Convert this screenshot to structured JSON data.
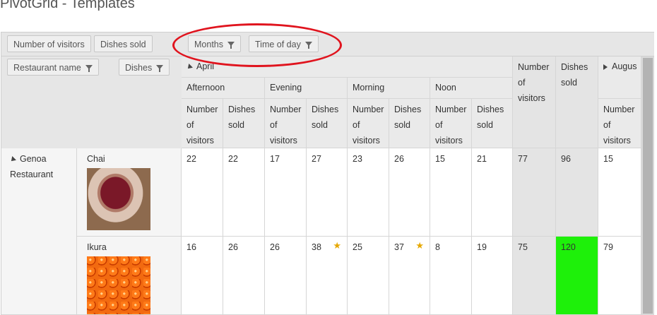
{
  "page": {
    "title": "PivotGrid - Templates"
  },
  "data_fields": {
    "visitors": "Number of visitors",
    "dishes": "Dishes sold"
  },
  "column_fields": {
    "months": "Months",
    "time_of_day": "Time of day"
  },
  "row_fields": {
    "restaurant": "Restaurant name",
    "dishes": "Dishes"
  },
  "columns": {
    "month1": "April",
    "month2": "Augus",
    "times": [
      "Afternoon",
      "Evening",
      "Morning",
      "Noon"
    ],
    "measure_visitors": "Number of visitors",
    "measure_dishes": "Dishes sold",
    "total_visitors": "Number of visitors",
    "total_dishes": "Dishes sold"
  },
  "rows": {
    "restaurant": "Genoa Restaurant",
    "items": [
      {
        "label": "Chai",
        "image": "chai-image",
        "values": [
          "22",
          "22",
          "17",
          "27",
          "23",
          "26",
          "15",
          "21"
        ],
        "total_visitors": "77",
        "total_dishes": "96",
        "next": "15"
      },
      {
        "label": "Ikura",
        "image": "ikura-image",
        "values": [
          "16",
          "26",
          "26",
          "38",
          "25",
          "37",
          "8",
          "19"
        ],
        "total_visitors": "75",
        "total_dishes": "120",
        "next": "79",
        "starred_indices": [
          3,
          5
        ]
      }
    ]
  },
  "colors": {
    "highlight": "#1ef00a",
    "annotation": "#e0141e",
    "star": "#e6a800"
  },
  "icons": {
    "filter": "filter-icon",
    "star": "star-icon",
    "expanded": "expanded-triangle-icon",
    "collapsed": "collapsed-triangle-icon"
  }
}
